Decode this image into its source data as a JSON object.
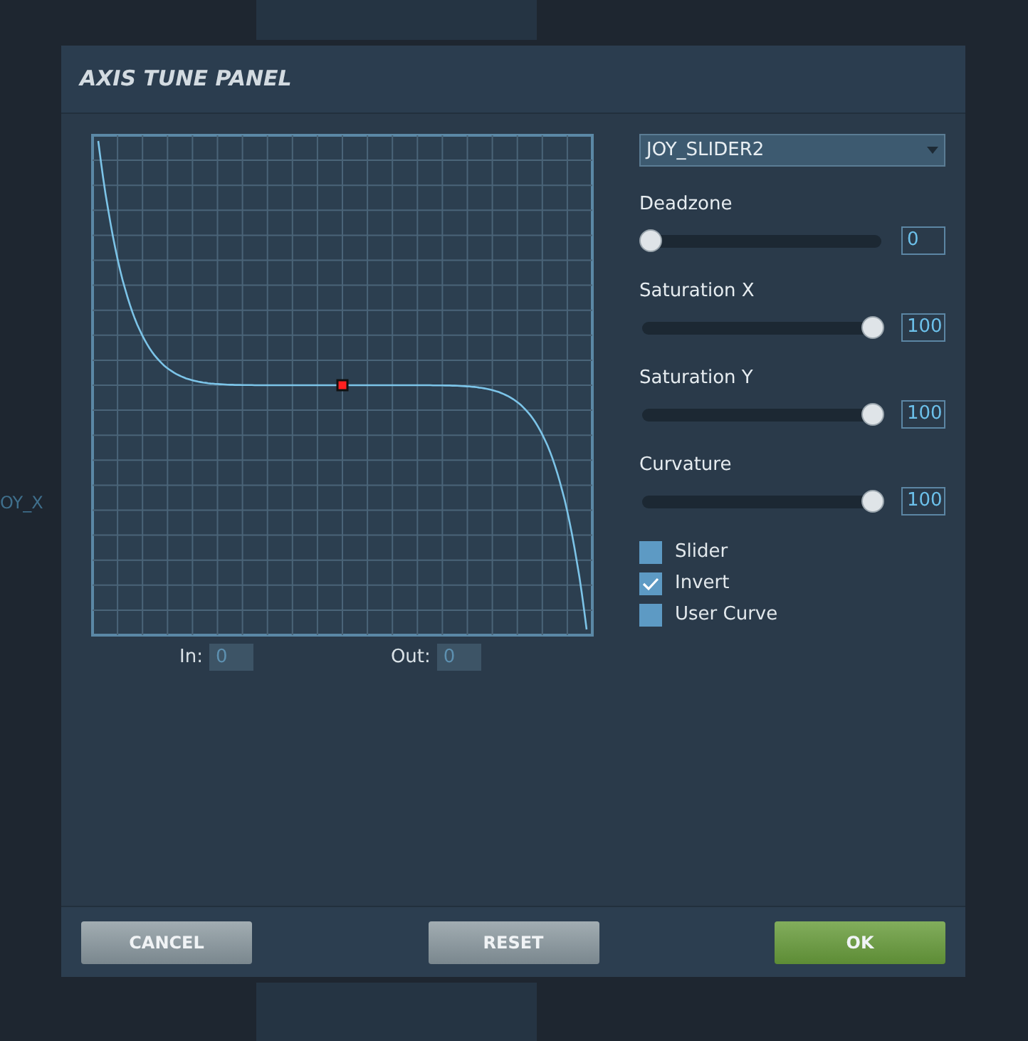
{
  "background": {
    "label": "OY_X"
  },
  "window": {
    "title": "AXIS TUNE PANEL"
  },
  "graph": {
    "in_label": "In:",
    "in_value": "0",
    "out_label": "Out:",
    "out_value": "0"
  },
  "axis_select": {
    "value": "JOY_SLIDER2"
  },
  "sliders": [
    {
      "label": "Deadzone",
      "level": 0,
      "reading": "0"
    },
    {
      "label": "Saturation X",
      "level": 1,
      "reading": "100"
    },
    {
      "label": "Saturation Y",
      "level": 1,
      "reading": "100"
    },
    {
      "label": "Curvature",
      "level": 1,
      "reading": "100"
    }
  ],
  "options": [
    {
      "label": "Slider",
      "checked": false
    },
    {
      "label": "Invert",
      "checked": true
    },
    {
      "label": "User Curve",
      "checked": false
    }
  ],
  "buttons": [
    {
      "label": "CANCEL",
      "kind": "secondary"
    },
    {
      "label": "RESET",
      "kind": "secondary"
    },
    {
      "label": "OK",
      "kind": "primary"
    }
  ]
}
